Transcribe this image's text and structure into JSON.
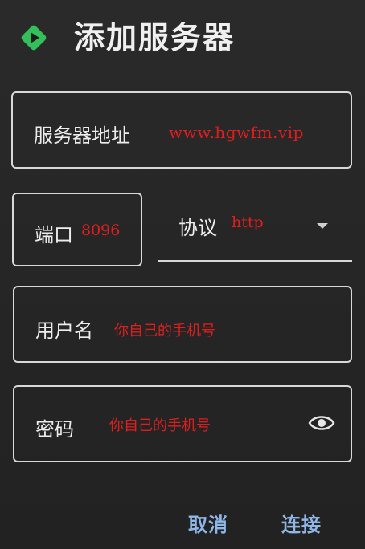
{
  "dialog": {
    "title": "添加服务器",
    "logo_icon": "play-diamond-icon"
  },
  "fields": {
    "server": {
      "label": "服务器地址",
      "value": "www.hgwfm.vip"
    },
    "port": {
      "label": "端口",
      "value": "8096"
    },
    "protocol": {
      "label": "协议",
      "value": "http",
      "icon": "chevron-down-icon"
    },
    "username": {
      "label": "用户名",
      "value": "你自己的手机号"
    },
    "password": {
      "label": "密码",
      "value": "你自己的手机号",
      "icon": "eye-icon"
    }
  },
  "actions": {
    "cancel_label": "取消",
    "connect_label": "连接"
  },
  "colors": {
    "background": "#262626",
    "accent": "#8fb6e6",
    "logo_green": "#33c05a",
    "annotation_red": "#e01e1e"
  }
}
